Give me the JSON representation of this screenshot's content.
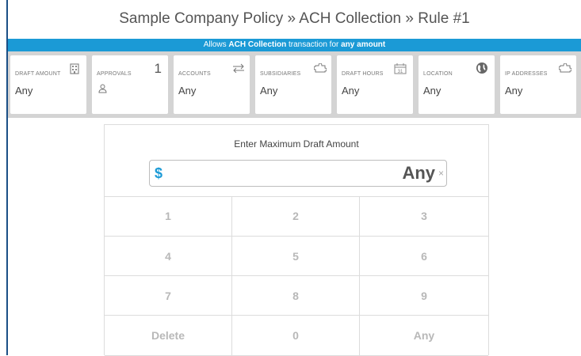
{
  "header": {
    "breadcrumb": "Sample Company Policy » ACH Collection » Rule #1"
  },
  "banner": {
    "prefix": "Allows ",
    "transaction": "ACH Collection",
    "middle": " transaction for ",
    "amount": "any amount"
  },
  "cards": [
    {
      "label": "Draft Amount",
      "value": "Any",
      "icon": "building-icon"
    },
    {
      "label": "Approvals",
      "count": "1",
      "icon": "person-icon"
    },
    {
      "label": "Accounts",
      "value": "Any",
      "icon": "swap-arrows-icon"
    },
    {
      "label": "Subsidiaries",
      "value": "Any",
      "icon": "puzzle-icon"
    },
    {
      "label": "Draft Hours",
      "value": "Any",
      "icon": "calendar-icon",
      "icon_text": "31"
    },
    {
      "label": "Location",
      "value": "Any",
      "icon": "globe-icon"
    },
    {
      "label": "IP Addresses",
      "value": "Any",
      "icon": "puzzle-icon"
    }
  ],
  "keypad": {
    "prompt": "Enter Maximum Draft Amount",
    "currency_symbol": "$",
    "amount_value": "Any",
    "clear_symbol": "×",
    "keys": [
      "1",
      "2",
      "3",
      "4",
      "5",
      "6",
      "7",
      "8",
      "9",
      "Delete",
      "0",
      "Any"
    ]
  }
}
